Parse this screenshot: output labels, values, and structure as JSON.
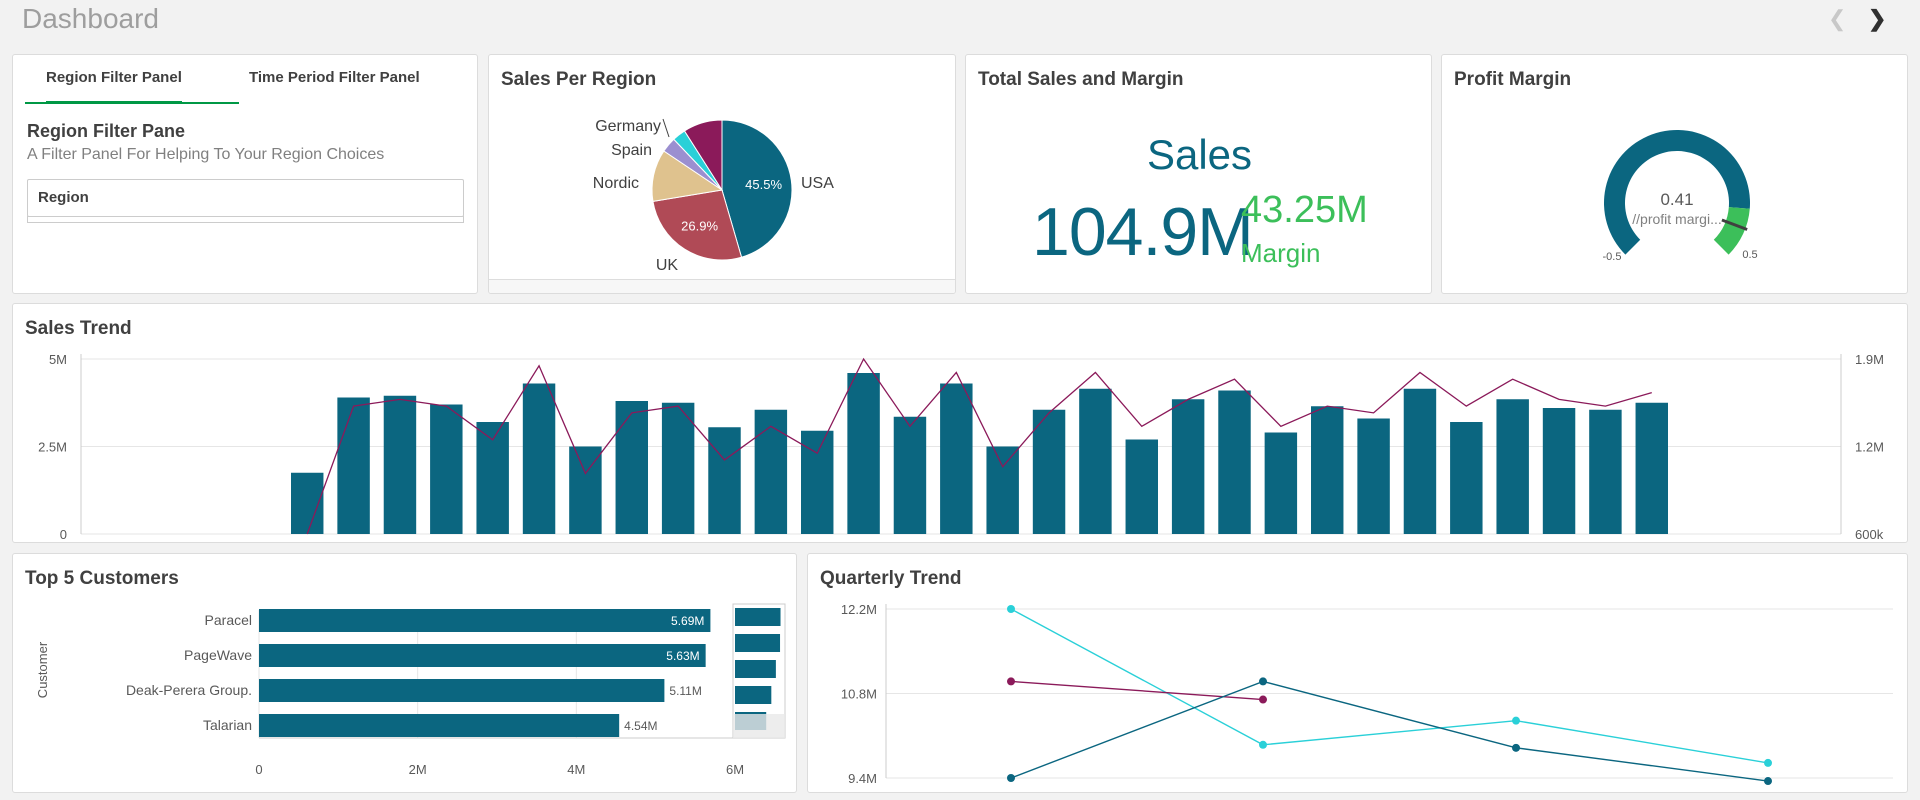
{
  "page": {
    "title": "Dashboard"
  },
  "colors": {
    "primary": "#0b6680",
    "accent_green": "#3cbf5a",
    "maroon": "#8b1a5a",
    "cyan": "#2ad0d8"
  },
  "filter_panel": {
    "tabs": [
      {
        "label": "Region Filter Panel",
        "active": true
      },
      {
        "label": "Time Period Filter Panel",
        "active": false
      }
    ],
    "heading": "Region Filter Pane",
    "subtitle": "A Filter Panel For Helping To Your Region Choices",
    "field": "Region"
  },
  "pie_card": {
    "title": "Sales Per Region"
  },
  "kpi_card": {
    "title": "Total Sales and Margin",
    "main_label": "Sales",
    "main_value": "104.9M",
    "secondary_value": "43.25M",
    "secondary_label": "Margin"
  },
  "gauge_card": {
    "title": "Profit Margin"
  },
  "trend_card": {
    "title": "Sales Trend"
  },
  "top5_card": {
    "title": "Top 5 Customers"
  },
  "quarter_card": {
    "title": "Quarterly Trend"
  },
  "chart_data": [
    {
      "type": "pie",
      "title": "Sales Per Region",
      "slices": [
        {
          "label": "USA",
          "value": 45.5,
          "data_label": "45.5%",
          "color": "#0b6680"
        },
        {
          "label": "UK",
          "value": 26.9,
          "data_label": "26.9%",
          "color": "#b04a56"
        },
        {
          "label": "Nordic",
          "value": 12.0,
          "data_label": "",
          "color": "#dfc28e"
        },
        {
          "label": "Spain",
          "value": 3.5,
          "data_label": "",
          "color": "#9b8fd0"
        },
        {
          "label": "Germany",
          "value": 3.1,
          "data_label": "",
          "color": "#2ad0d8"
        },
        {
          "label": "",
          "value": 9.0,
          "data_label": "",
          "color": "#8b1a5a"
        }
      ]
    },
    {
      "type": "gauge",
      "title": "Profit Margin",
      "value": 0.41,
      "value_label": "0.41",
      "measure_label": "//profit margi...",
      "min": -0.5,
      "max": 0.5,
      "min_label": "-0.5",
      "max_label": "0.5",
      "segment_limit": 0.35,
      "colors": [
        "#0b6680",
        "#3cbf5a"
      ]
    },
    {
      "type": "bar",
      "title": "Sales Trend",
      "series": [
        {
          "name": "Sales",
          "type": "bar",
          "axis": "left",
          "values": [
            0,
            0,
            0,
            0,
            0,
            1.75,
            3.9,
            3.95,
            3.7,
            3.2,
            4.3,
            2.5,
            3.8,
            3.75,
            3.05,
            3.55,
            2.95,
            4.6,
            3.35,
            4.3,
            2.5,
            3.55,
            4.15,
            2.7,
            3.85,
            4.1,
            2.9,
            3.65,
            3.3,
            4.15,
            3.2,
            3.85,
            3.6,
            3.55,
            3.75
          ]
        },
        {
          "name": "Margin",
          "type": "line",
          "axis": "right",
          "values": [
            null,
            null,
            null,
            null,
            null,
            0.6,
            1.55,
            1.6,
            1.55,
            1.3,
            1.85,
            1.05,
            1.5,
            1.55,
            1.15,
            1.4,
            1.2,
            1.9,
            1.4,
            1.8,
            1.1,
            1.5,
            1.8,
            1.4,
            1.6,
            1.75,
            1.4,
            1.55,
            1.5,
            1.8,
            1.55,
            1.75,
            1.6,
            1.55,
            1.65
          ]
        }
      ],
      "ylim_left": [
        0,
        5
      ],
      "ylim_right": [
        0.6,
        1.9
      ],
      "left_ticks": [
        "5M",
        "2.5M",
        "0"
      ],
      "right_ticks": [
        "1.9M",
        "1.2M",
        "600k"
      ],
      "grid": true
    },
    {
      "type": "bar",
      "orientation": "horizontal",
      "title": "Top 5 Customers",
      "ylabel": "Customer",
      "categories": [
        "Paracel",
        "PageWave",
        "Deak-Perera Group.",
        "Talarian"
      ],
      "values": [
        5.69,
        5.63,
        5.11,
        4.54
      ],
      "data_labels": [
        "5.69M",
        "5.63M",
        "5.11M",
        "4.54M"
      ],
      "xlim": [
        0,
        6
      ],
      "x_ticks": [
        "0",
        "2M",
        "4M",
        "6M"
      ],
      "minimap_values": [
        5.69,
        5.63,
        5.11,
        4.54,
        3.9
      ]
    },
    {
      "type": "line",
      "title": "Quarterly Trend",
      "ylim": [
        9.4,
        12.2
      ],
      "y_ticks": [
        "12.2M",
        "10.8M",
        "9.4M"
      ],
      "series": [
        {
          "color": "#2ad0d8",
          "values": [
            12.2,
            9.95,
            10.35,
            9.65
          ]
        },
        {
          "color": "#8b1a5a",
          "values": [
            11.0,
            10.7,
            null,
            null
          ]
        },
        {
          "color": "#0b6680",
          "values": [
            9.4,
            11.0,
            9.9,
            9.35
          ]
        }
      ],
      "grid": true
    }
  ]
}
